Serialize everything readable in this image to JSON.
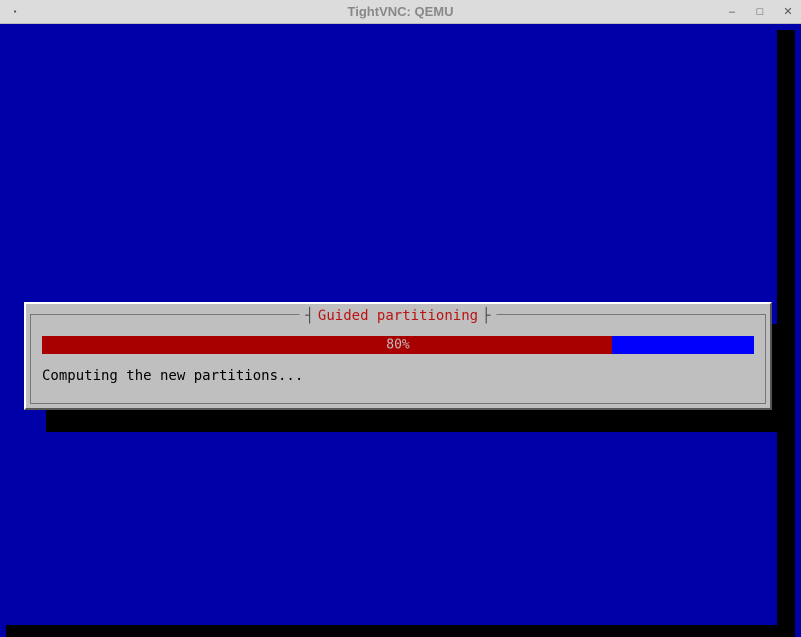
{
  "window": {
    "title": "TightVNC: QEMU",
    "icon": "▪"
  },
  "dialog": {
    "title": "Guided partitioning",
    "progress_percent": 80,
    "progress_label": "80%",
    "status": "Computing the new partitions..."
  },
  "colors": {
    "background": "#0000a8",
    "dialog_bg": "#bfbfbf",
    "progress_fill": "#a80000",
    "progress_track": "#0000fc"
  }
}
